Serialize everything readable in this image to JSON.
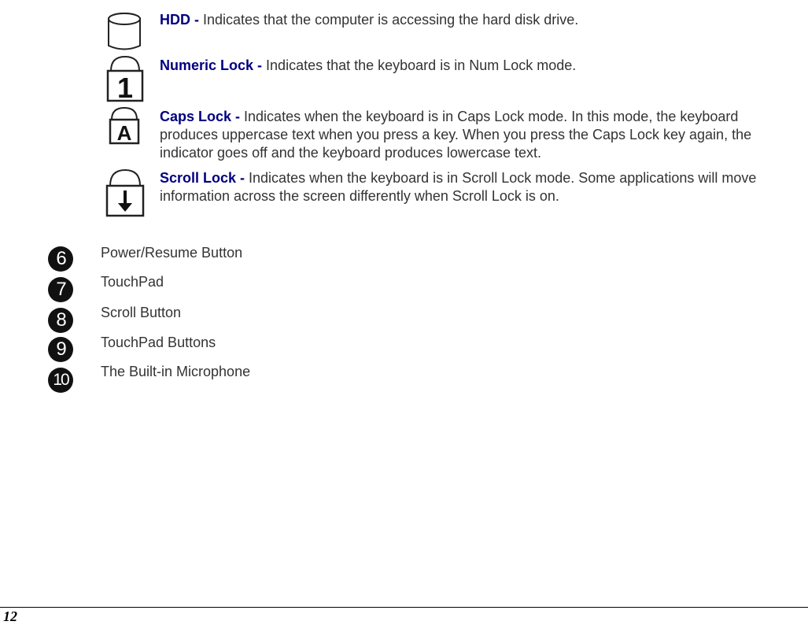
{
  "indicators": [
    {
      "icon": "hdd-icon",
      "title": "HDD - ",
      "text": "Indicates that the computer is accessing the hard disk drive."
    },
    {
      "icon": "numeric-lock-icon",
      "glyph": "1",
      "title": "Numeric Lock - ",
      "text": "Indicates that the keyboard is in Num Lock mode."
    },
    {
      "icon": "caps-lock-icon",
      "glyph": "A",
      "title": "Caps Lock - ",
      "text": "Indicates when the keyboard is in Caps Lock mode.  In this mode, the keyboard produces uppercase text when you press a key.  When you press the Caps Lock key again, the indicator goes off and the keyboard produces lowercase text."
    },
    {
      "icon": "scroll-lock-icon",
      "glyph": "↓",
      "title": "Scroll Lock - ",
      "text": "Indicates when the keyboard is in Scroll Lock mode.  Some applications will move information across the screen differently when Scroll Lock is on."
    }
  ],
  "items": [
    {
      "number": "6",
      "label": "Power/Resume Button"
    },
    {
      "number": "7",
      "label": "TouchPad"
    },
    {
      "number": "8",
      "label": "Scroll Button"
    },
    {
      "number": "9",
      "label": "TouchPad Buttons"
    },
    {
      "number": "10",
      "label": "The Built-in Microphone"
    }
  ],
  "footer": {
    "page_number": "12"
  }
}
